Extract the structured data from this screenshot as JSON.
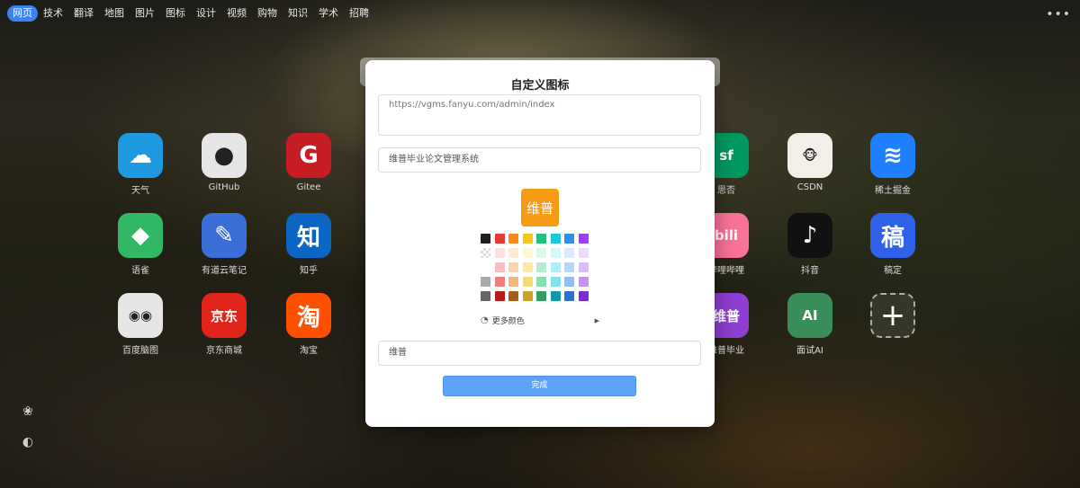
{
  "nav": {
    "items": [
      "网页",
      "技术",
      "翻译",
      "地图",
      "图片",
      "图标",
      "设计",
      "视频",
      "购物",
      "知识",
      "学术",
      "招聘"
    ],
    "more": "•••"
  },
  "tiles": [
    {
      "label": "天气",
      "icon": "weather-icon",
      "color": "#1e9be0",
      "glyph": "☁"
    },
    {
      "label": "GitHub",
      "icon": "github-icon",
      "color": "#e6e6e6",
      "glyph": "●"
    },
    {
      "label": "Gitee",
      "icon": "gitee-icon",
      "color": "#c71d23",
      "glyph": "G"
    },
    {
      "label": "语雀",
      "icon": "yuque-icon",
      "color": "#31b864",
      "glyph": "◆"
    },
    {
      "label": "有道云笔记",
      "icon": "youdao-note-icon",
      "color": "#3b6fd8",
      "glyph": "✎"
    },
    {
      "label": "知乎",
      "icon": "zhihu-icon",
      "color": "#0a66c2",
      "glyph": "知"
    },
    {
      "label": "百度脑图",
      "icon": "baidu-mindmap-icon",
      "color": "#e6e6e6",
      "glyph": "◉◉"
    },
    {
      "label": "京东商城",
      "icon": "jd-icon",
      "color": "#e1251b",
      "glyph": "京东"
    },
    {
      "label": "淘宝",
      "icon": "taobao-icon",
      "color": "#ff5000",
      "glyph": "淘"
    },
    {
      "label": "思否",
      "icon": "segmentfault-icon",
      "color": "#009a61",
      "glyph": "sf"
    },
    {
      "label": "CSDN",
      "icon": "csdn-icon",
      "color": "#f2efe8",
      "glyph": "🐵"
    },
    {
      "label": "稀土掘金",
      "icon": "juejin-icon",
      "color": "#1e80ff",
      "glyph": "≋"
    },
    {
      "label": "哔哩哔哩",
      "icon": "bilibili-icon",
      "color": "#fb7299",
      "glyph": "bili"
    },
    {
      "label": "抖音",
      "icon": "douyin-icon",
      "color": "#111111",
      "glyph": "♪"
    },
    {
      "label": "稿定",
      "icon": "gaoding-icon",
      "color": "#2f62e8",
      "glyph": "稿"
    },
    {
      "label": "维普毕业",
      "icon": "weipu-icon",
      "color": "#8e3fd1",
      "glyph": "维普"
    },
    {
      "label": "面试AI",
      "icon": "interview-ai-icon",
      "color": "#3a8e5a",
      "glyph": "AI"
    }
  ],
  "add_tile_glyph": "+",
  "modal": {
    "title": "自定义图标",
    "url_value": "https://vgms.fanyu.com/admin/index",
    "name_value": "维普毕业论文管理系统",
    "preview_text": "维普",
    "preview_color": "#f79a14",
    "more_colors_label": "更多颜色",
    "text_value": "维普",
    "done_label": "完成"
  },
  "palette": [
    [
      "#1f1f1f",
      "#e53935",
      "#f7891c",
      "#f5c518",
      "#22c07a",
      "#19c9d8",
      "#2f8ff0",
      "#9b3ff0"
    ],
    [
      "transparent",
      "#fde2e2",
      "#fdebd8",
      "#fdf6d6",
      "#dcf7e8",
      "#d8f6f9",
      "#dbeafd",
      "#eedcfd"
    ],
    [
      "#ffffff",
      "#f8bdbd",
      "#f8d4b0",
      "#f9eaa8",
      "#b8ecd0",
      "#aeeef4",
      "#b6d6fa",
      "#dcbcfa"
    ],
    [
      "#a9a9a9",
      "#ee7f7f",
      "#f2b77e",
      "#f3dc74",
      "#86dfae",
      "#7ee3ec",
      "#8ebff6",
      "#c394f6"
    ],
    [
      "#666666",
      "#b71c1c",
      "#a35f1a",
      "#c9a227",
      "#2e9e63",
      "#1199a8",
      "#2e6fcf",
      "#7a2ccc"
    ]
  ]
}
